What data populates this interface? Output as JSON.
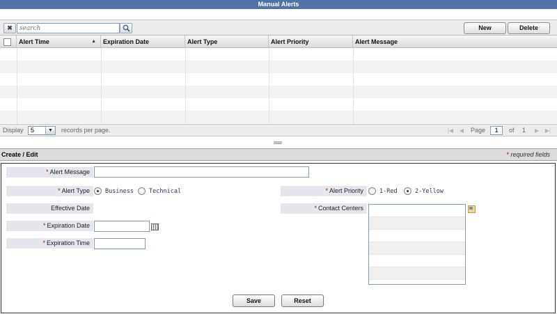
{
  "window": {
    "title": "Manual Alerts"
  },
  "toolbar": {
    "clear_icon": "✖",
    "search_placeholder": "search",
    "search_icon": "magnifier",
    "new_label": "New",
    "delete_label": "Delete"
  },
  "grid": {
    "columns": [
      "Alert Time",
      "Expiration Date",
      "Alert Type",
      "Alert Priority",
      "Alert Message"
    ],
    "sort_column": "Alert Time",
    "sort_direction": "ascending",
    "sort_indicator": "▲",
    "rows": []
  },
  "pager": {
    "display_label": "Display",
    "page_size": "5",
    "records_label": "records per page.",
    "page_label": "Page",
    "current_page": "1",
    "of_label": "of",
    "total_pages": "1"
  },
  "edit_panel": {
    "title": "Create / Edit",
    "required_note": "required fields",
    "required_marker": "*"
  },
  "form": {
    "alert_message_label": "Alert Message",
    "alert_message_value": "",
    "alert_type_label": "Alert Type",
    "alert_type_options": [
      "Business",
      "Technical"
    ],
    "alert_type_selected": "Business",
    "alert_priority_label": "Alert Priority",
    "alert_priority_options": [
      "1-Red",
      "2-Yellow"
    ],
    "alert_priority_selected": "2-Yellow",
    "effective_date_label": "Effective Date",
    "contact_centers_label": "Contact Centers",
    "expiration_date_label": "Expiration Date",
    "expiration_date_value": "",
    "expiration_time_label": "Expiration Time",
    "expiration_time_value": "",
    "save_label": "Save",
    "reset_label": "Reset"
  }
}
